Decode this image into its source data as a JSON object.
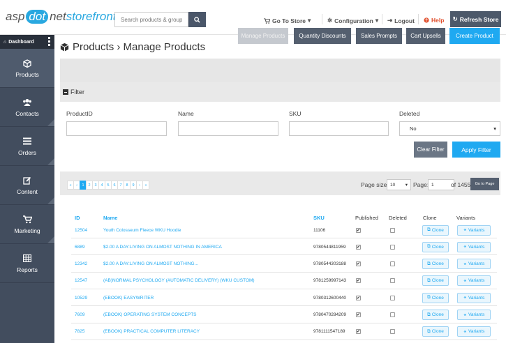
{
  "logo": {
    "asp": "asp",
    "dot": "dot",
    "net": "net",
    "storefront": "storefront"
  },
  "search": {
    "placeholder": "Search products & groups"
  },
  "header": {
    "go_to_store": "Go To Store",
    "configuration": "Configuration",
    "logout": "Logout",
    "help": "Help",
    "refresh_store": "Refresh Store"
  },
  "sidebar": {
    "dashboard": "Dashboard",
    "items": [
      {
        "label": "Products",
        "icon": "cube-icon"
      },
      {
        "label": "Contacts",
        "icon": "users-icon"
      },
      {
        "label": "Orders",
        "icon": "list-icon"
      },
      {
        "label": "Content",
        "icon": "edit-icon"
      },
      {
        "label": "Marketing",
        "icon": "cart-icon"
      },
      {
        "label": "Reports",
        "icon": "table-icon"
      }
    ]
  },
  "page": {
    "title": "Products › Manage Products"
  },
  "actions": {
    "manage_products": "Manage Products",
    "quantity_discounts": "Quantity Discounts",
    "sales_prompts": "Sales Prompts",
    "cart_upsells": "Cart Upsells",
    "create_product": "Create Product"
  },
  "filter": {
    "title": "Filter",
    "labels": {
      "product_id": "ProductID",
      "name": "Name",
      "sku": "SKU",
      "deleted": "Deleted"
    },
    "deleted_value": "No",
    "clear": "Clear Filter",
    "apply": "Apply Filter"
  },
  "pager": {
    "first": "«",
    "prev": "‹",
    "pages": [
      "1",
      "2",
      "3",
      "4",
      "5",
      "6",
      "7",
      "8",
      "9"
    ],
    "next": "›",
    "last": "»",
    "page_size_label": "Page size:",
    "page_size": "10",
    "page_label": "Page:",
    "page_value": "1",
    "of_total": "of 1455",
    "go": "Go to Page"
  },
  "table": {
    "headers": {
      "id": "ID",
      "name": "Name",
      "sku": "SKU",
      "published": "Published",
      "deleted": "Deleted",
      "clone": "Clone",
      "variants": "Variants"
    },
    "clone_label": "Clone",
    "variants_label": "Variants",
    "rows": [
      {
        "id": "12504",
        "name": "Youth Colosseum Fleece WKU Hoodie",
        "sku": "11106",
        "published": true,
        "deleted": false
      },
      {
        "id": "6889",
        "name": "$2.00 A DAY:LIVING ON ALMOST NOTHING IN AMERICA",
        "sku": "9780544811959",
        "published": true,
        "deleted": false
      },
      {
        "id": "12342",
        "name": "$2.00 A DAY:LIVING ON ALMOST NOTHING...",
        "sku": "9780544303188",
        "published": true,
        "deleted": false
      },
      {
        "id": "12547",
        "name": "(AB)NORMAL PSYCHOLOGY (AUTOMATIC DELIVERY) (WKU CUSTOM)",
        "sku": "9781259997143",
        "published": true,
        "deleted": false
      },
      {
        "id": "10529",
        "name": "(EBOOK) EASYWRITER",
        "sku": "9780312600440",
        "published": true,
        "deleted": false
      },
      {
        "id": "7609",
        "name": "(EBOOK) OPERATING SYSTEM CONCEPTS",
        "sku": "9780470284209",
        "published": true,
        "deleted": false
      },
      {
        "id": "7825",
        "name": "(EBOOK) PRACTICAL COMPUTER LITERACY",
        "sku": "9781111547189",
        "published": true,
        "deleted": false
      }
    ]
  }
}
